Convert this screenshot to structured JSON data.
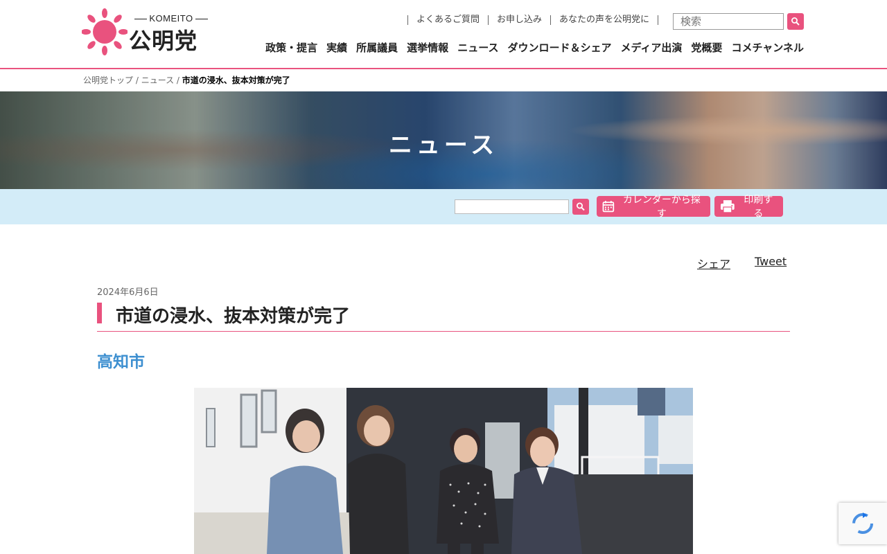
{
  "logo": {
    "en": "KOMEITO",
    "jp": "公明党"
  },
  "utility_links": [
    "よくあるご質問",
    "お申し込み",
    "あなたの声を公明党に"
  ],
  "header_search": {
    "placeholder": "検索"
  },
  "global_nav": [
    "政策・提言",
    "実績",
    "所属議員",
    "選挙情報",
    "ニュース",
    "ダウンロード＆シェア",
    "メディア出演",
    "党概要",
    "コメチャンネル"
  ],
  "breadcrumb": {
    "home": "公明党トップ",
    "section": "ニュース",
    "current": "市道の浸水、抜本対策が完了",
    "sep": " / "
  },
  "hero": {
    "title": "ニュース"
  },
  "toolbar": {
    "calendar_label": "カレンダーから探す",
    "print_label": "印刷する"
  },
  "share": {
    "share_label": "シェア",
    "tweet_label": "Tweet"
  },
  "article": {
    "date": "2024年6月6日",
    "title": "市道の浸水、抜本対策が完了",
    "location": "高知市"
  },
  "icons": [
    "sun-logo-icon",
    "search-icon",
    "calendar-icon",
    "printer-icon",
    "recaptcha-icon"
  ],
  "colors": {
    "accent": "#e9527e",
    "toolbar_bg": "#d3ecf8",
    "location_blue": "#3d8fd0"
  }
}
